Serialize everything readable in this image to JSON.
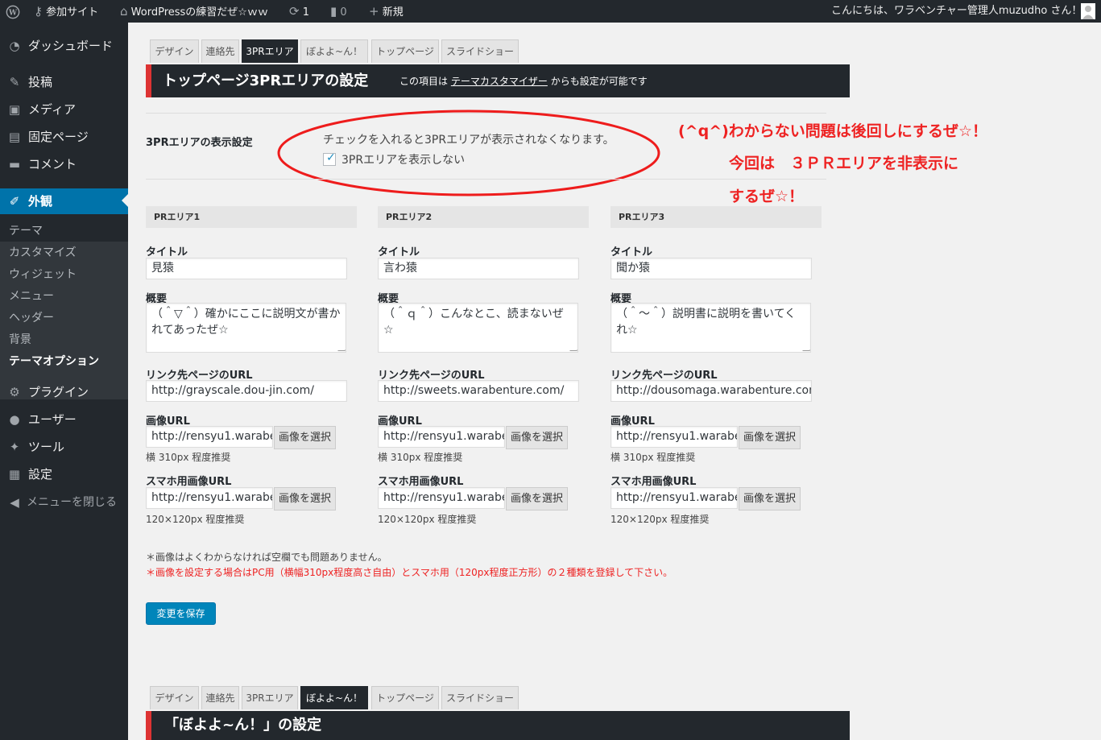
{
  "adminbar": {
    "my_sites": "参加サイト",
    "site_name": "WordPressの練習だぜ☆ｗｗ",
    "updates_count": "1",
    "comments_count": "0",
    "new_label": "新規",
    "greeting": "こんにちは、ワラベンチャー管理人muzudho さん！"
  },
  "sidebar": {
    "items": [
      {
        "label": "ダッシュボード",
        "icon": "dashboard-icon"
      },
      {
        "label": "投稿",
        "icon": "pin-icon"
      },
      {
        "label": "メディア",
        "icon": "media-icon"
      },
      {
        "label": "固定ページ",
        "icon": "page-icon"
      },
      {
        "label": "コメント",
        "icon": "comment-icon"
      },
      {
        "label": "外観",
        "icon": "appearance-icon"
      },
      {
        "label": "プラグイン",
        "icon": "plugin-icon"
      },
      {
        "label": "ユーザー",
        "icon": "user-icon"
      },
      {
        "label": "ツール",
        "icon": "tools-icon"
      },
      {
        "label": "設定",
        "icon": "settings-icon"
      },
      {
        "label": "メニューを閉じる",
        "icon": "collapse-icon"
      }
    ],
    "submenu": [
      "テーマ",
      "カスタマイズ",
      "ウィジェット",
      "メニュー",
      "ヘッダー",
      "背景",
      "テーマオプション"
    ]
  },
  "tabs": [
    "デザイン",
    "連絡先",
    "3PRエリア",
    "ぼよよ~ん！",
    "トップページ",
    "スライドショー"
  ],
  "section1": {
    "title": "トップページ3PRエリアの設定",
    "note_prefix": "この項目は",
    "note_link": "テーマカスタマイザー",
    "note_suffix": "からも設定が可能です"
  },
  "display_setting": {
    "label": "3PRエリアの表示設定",
    "description": "チェックを入れると3PRエリアが表示されなくなります。",
    "checkbox_label": "3PRエリアを表示しない",
    "checked": true
  },
  "columns": [
    {
      "header": "PRエリア1",
      "title": "見猿",
      "summary": "（＾▽＾）確かにここに説明文が書かれてあったぜ☆",
      "link": "http://grayscale.dou-jin.com/",
      "image": "http://rensyu1.warabe",
      "sp_image": "http://rensyu1.warabe"
    },
    {
      "header": "PRエリア2",
      "title": "言わ猿",
      "summary": "（＾ｑ＾）こんなとこ、読まないぜ☆",
      "link": "http://sweets.warabenture.com/",
      "image": "http://rensyu1.warabe",
      "sp_image": "http://rensyu1.warabe"
    },
    {
      "header": "PRエリア3",
      "title": "聞か猿",
      "summary": "（＾～＾）説明書に説明を書いてくれ☆",
      "link": "http://dousomaga.warabenture.com",
      "image": "http://rensyu1.warabe",
      "sp_image": "http://rensyu1.warabe"
    }
  ],
  "field_labels": {
    "title": "タイトル",
    "summary": "概要",
    "link": "リンク先ページのURL",
    "image": "画像URL",
    "sp_image": "スマホ用画像URL",
    "select_button": "画像を選択",
    "image_hint": "横 310px 程度推奨",
    "sp_hint": "120×120px 程度推奨"
  },
  "notes": {
    "note1": "＊画像はよくわからなければ空欄でも問題ありません。",
    "note2": "＊画像を設定する場合はPC用（横幅310px程度高さ自由）とスマホ用（120px程度正方形）の２種類を登録して下さい。"
  },
  "save_button": "変更を保存",
  "annotation": {
    "line1": "(^q^)わからない問題は後回しにするぜ☆！",
    "line2": "今回は　３ＰＲエリアを非表示に",
    "line3": "するぜ☆！"
  },
  "section2": {
    "title": "「ぼよよ~ん！」の設定"
  },
  "colors": {
    "adminbar": "#23282d",
    "accent": "#0073aa",
    "header_stripe": "#dd3333",
    "annotation": "#ee2222"
  }
}
